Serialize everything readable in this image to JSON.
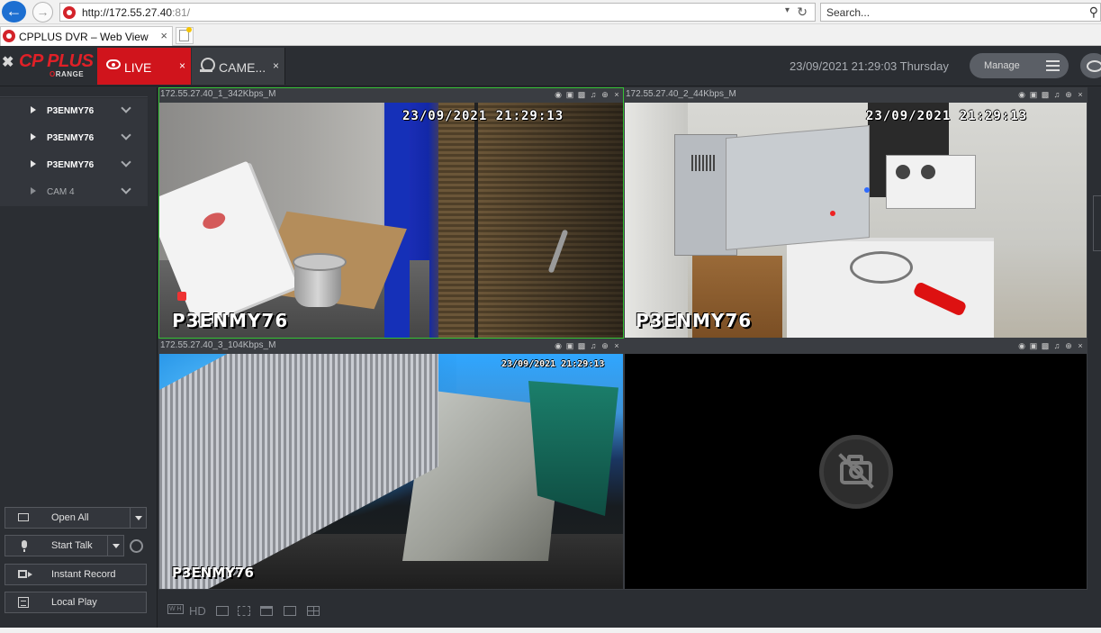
{
  "browser": {
    "url_prefix": "http://172.55.27.40",
    "url_suffix": ":81/",
    "search_placeholder": "Search...",
    "tab_title": "CPPLUS DVR – Web View"
  },
  "header": {
    "logo_main": "CP PLUS",
    "logo_sub": "ORANGE",
    "tabs": [
      {
        "label": "LIVE",
        "close": "×"
      },
      {
        "label": "CAME...",
        "close": "×"
      }
    ],
    "datetime": "23/09/2021 21:29:03 Thursday",
    "manage_label": "Manage"
  },
  "sidebar": {
    "devices": [
      {
        "label": "P3ENMY76"
      },
      {
        "label": "P3ENMY76"
      },
      {
        "label": "P3ENMY76"
      },
      {
        "label": "CAM 4"
      }
    ],
    "buttons": [
      {
        "label": "Open All"
      },
      {
        "label": "Start Talk"
      },
      {
        "label": "Instant Record"
      },
      {
        "label": "Local Play"
      }
    ]
  },
  "panes": [
    {
      "title": "172.55.27.40_1_342Kbps_M",
      "osd_time": "23/09/2021  21:29:13",
      "osd_name": "P3ENMY76"
    },
    {
      "title": "172.55.27.40_2_44Kbps_M",
      "osd_time": "23/09/2021  21:29:13",
      "osd_name": "P3ENMY76"
    },
    {
      "title": "172.55.27.40_3_104Kbps_M",
      "osd_time": "23/09/2021  21:29:13",
      "osd_name": "P3ENMY76"
    },
    {
      "title": ""
    }
  ],
  "bottom_bar": {
    "wh_label": "W H",
    "hd_label": "HD"
  },
  "colors": {
    "accent": "#d0141c",
    "selected_border": "#34c234",
    "background": "#2b2e33"
  }
}
